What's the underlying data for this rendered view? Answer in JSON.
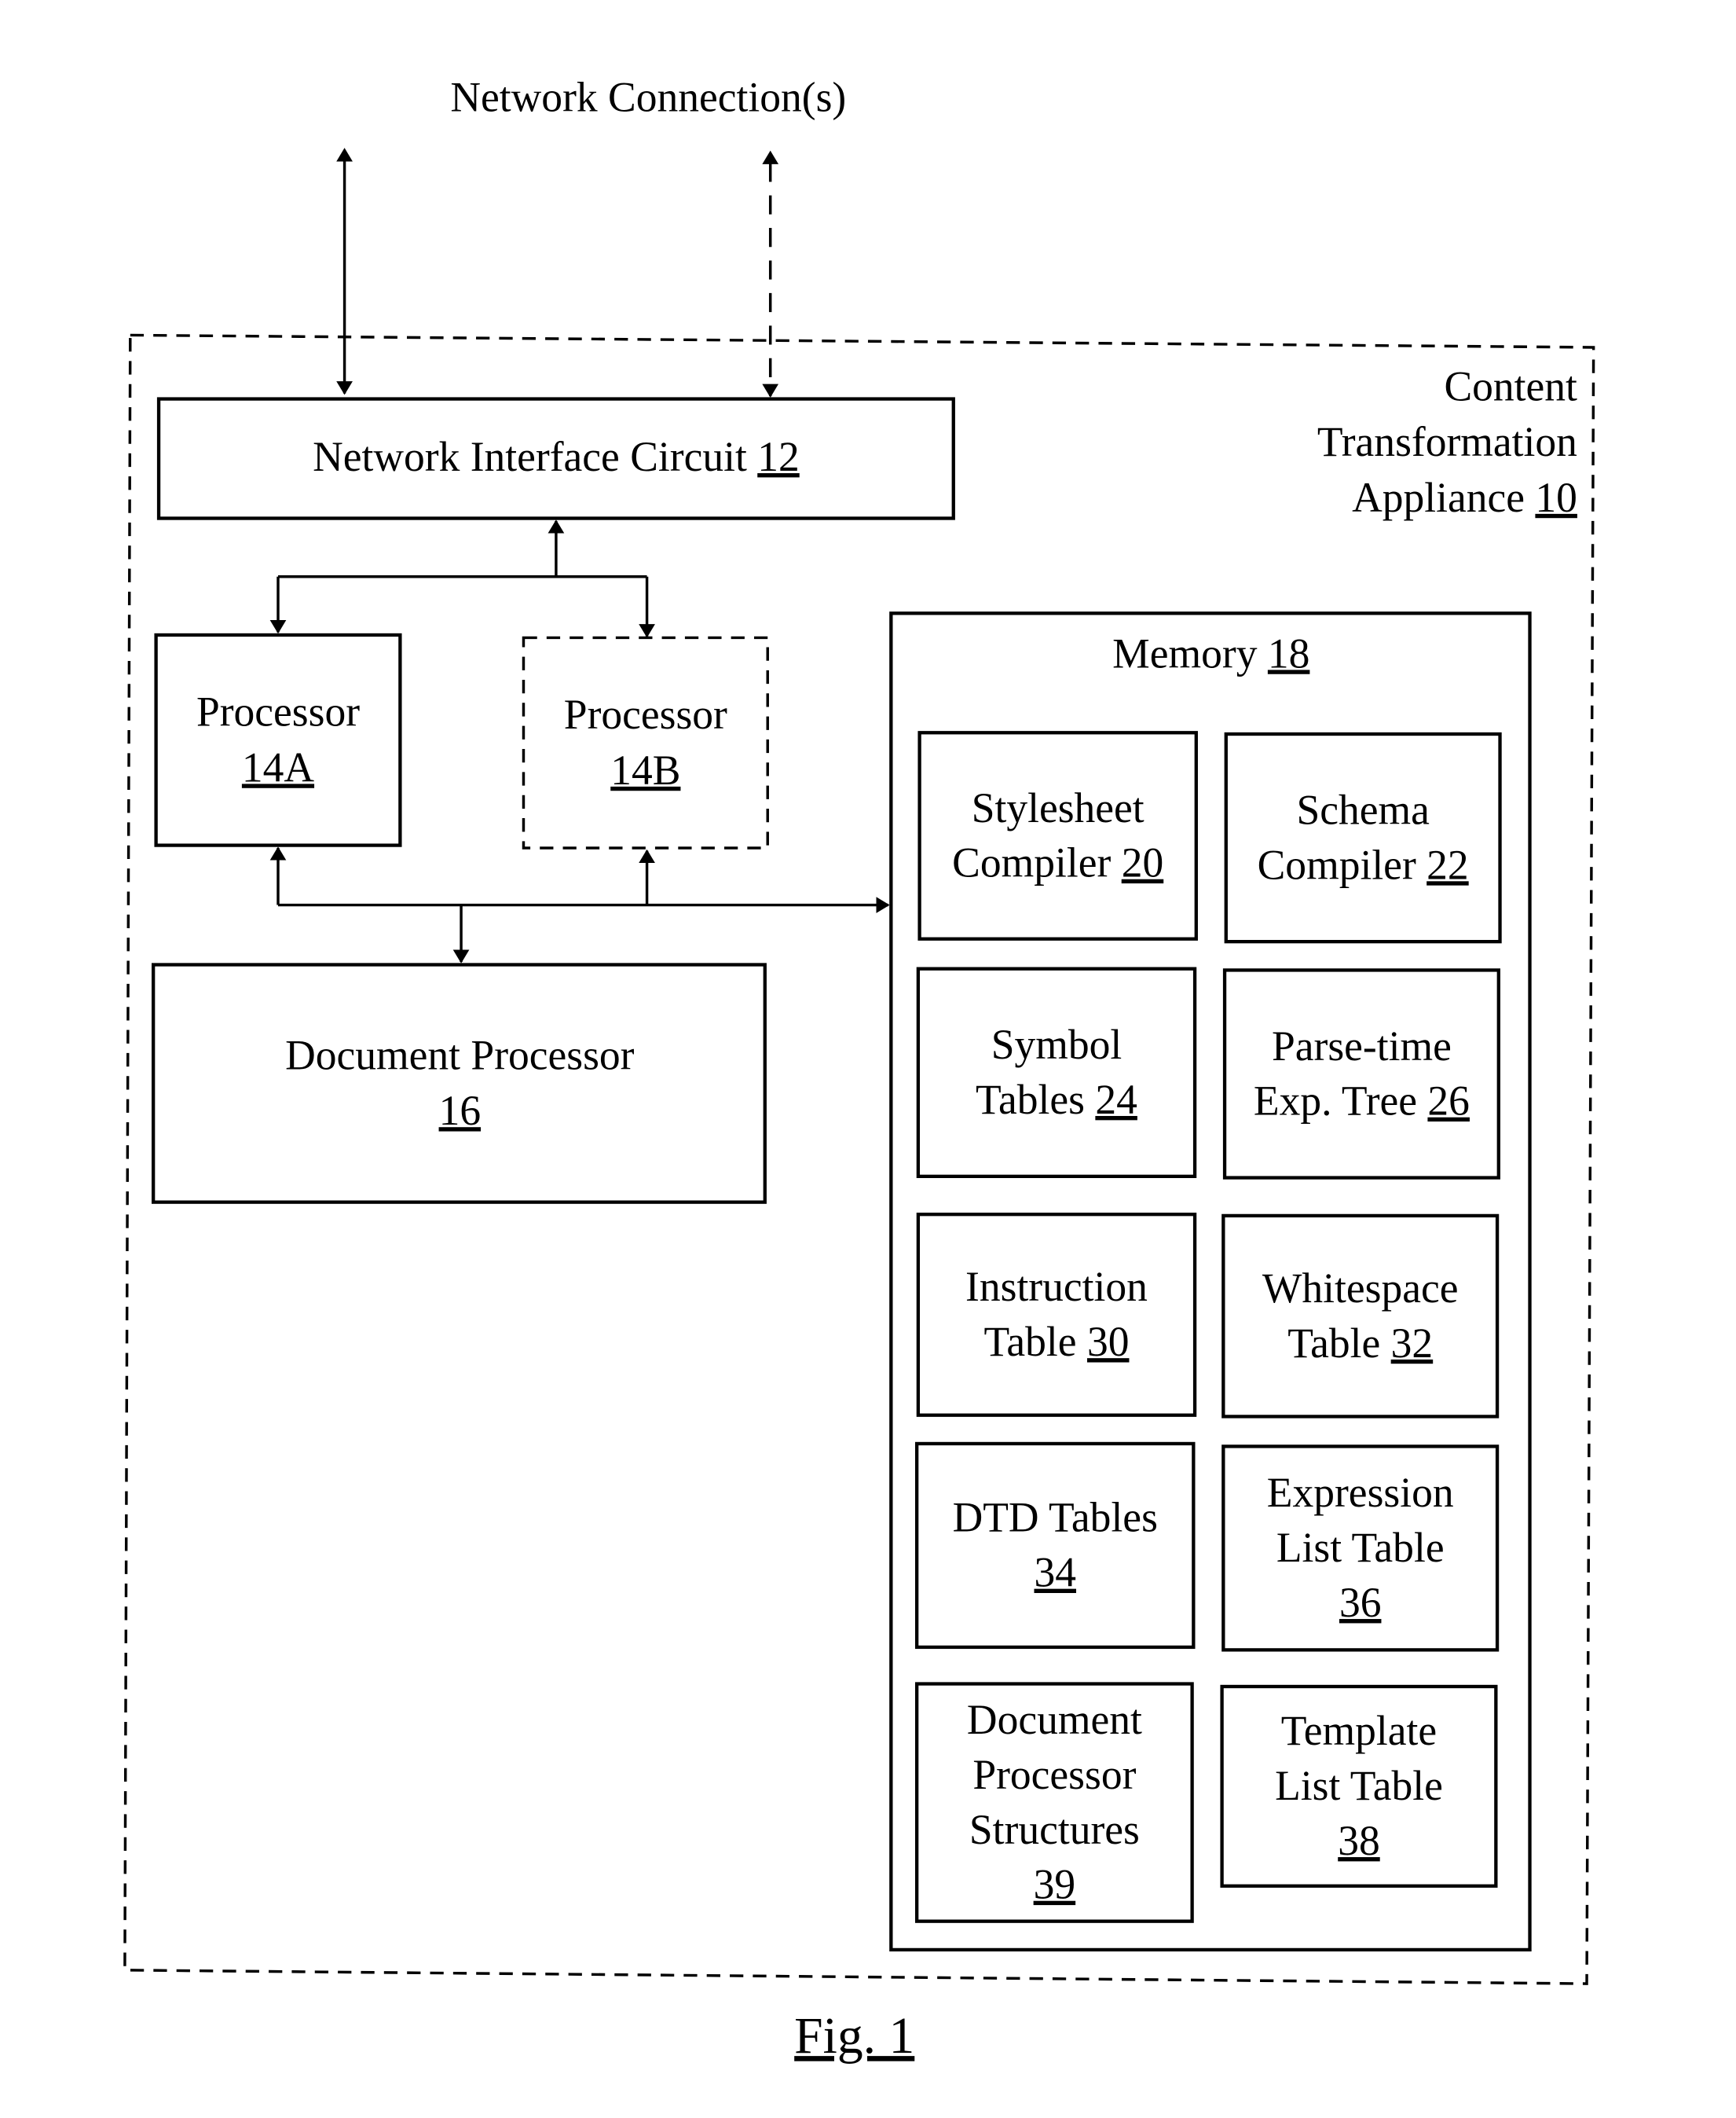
{
  "figure": {
    "caption": "Fig. 1",
    "network_connections_label": "Network Connection(s)",
    "appliance": {
      "lines": [
        "Content",
        "Transformation",
        "Appliance"
      ],
      "ref": "10"
    },
    "network_interface": {
      "label": "Network Interface Circuit",
      "ref": "12"
    },
    "processor_a": {
      "label": "Processor",
      "ref": "14A"
    },
    "processor_b": {
      "label": "Processor",
      "ref": "14B",
      "optional": true
    },
    "document_processor": {
      "label": "Document Processor",
      "ref": "16"
    },
    "memory": {
      "label": "Memory",
      "ref": "18"
    },
    "memory_items": [
      {
        "lines": [
          "Stylesheet",
          "Compiler"
        ],
        "ref": "20",
        "ref_inline": true
      },
      {
        "lines": [
          "Schema",
          "Compiler"
        ],
        "ref": "22",
        "ref_inline": true
      },
      {
        "lines": [
          "Symbol",
          "Tables"
        ],
        "ref": "24",
        "ref_inline": true
      },
      {
        "lines": [
          "Parse-time",
          "Exp. Tree"
        ],
        "ref": "26",
        "ref_inline": true
      },
      {
        "lines": [
          "Instruction",
          "Table"
        ],
        "ref": "30",
        "ref_inline": true
      },
      {
        "lines": [
          "Whitespace",
          "Table"
        ],
        "ref": "32",
        "ref_inline": true
      },
      {
        "lines": [
          "DTD Tables"
        ],
        "ref": "34",
        "ref_inline": false
      },
      {
        "lines": [
          "Expression",
          "List Table"
        ],
        "ref": "36",
        "ref_inline": false
      },
      {
        "lines": [
          "Document",
          "Processor",
          "Structures"
        ],
        "ref": "39",
        "ref_inline": false
      },
      {
        "lines": [
          "Template",
          "List Table"
        ],
        "ref": "38",
        "ref_inline": false
      }
    ]
  }
}
